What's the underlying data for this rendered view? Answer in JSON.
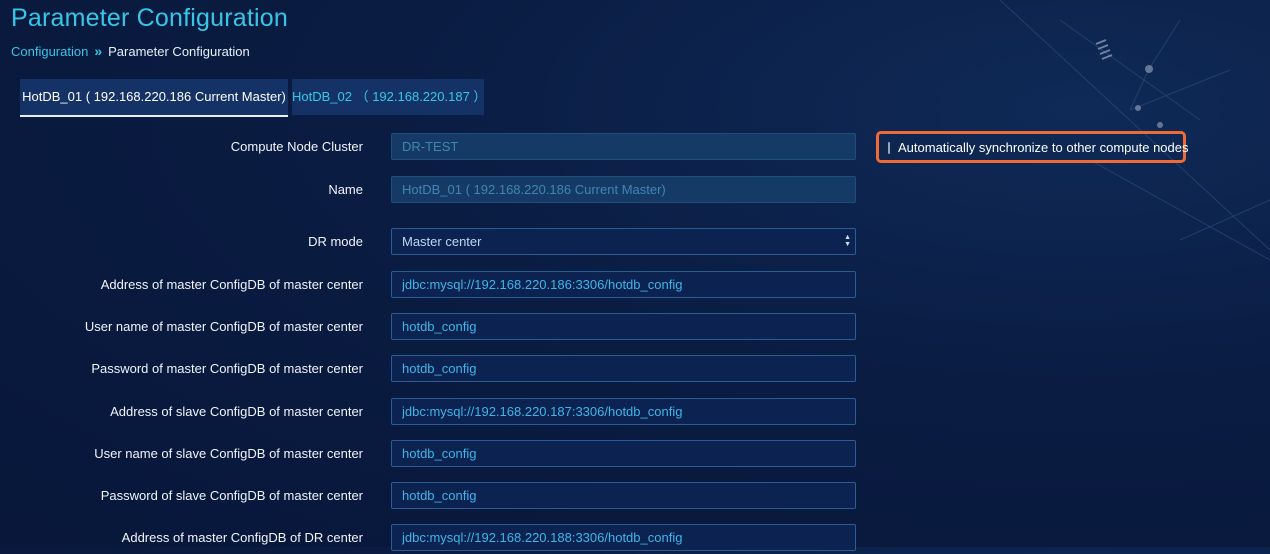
{
  "page": {
    "title": "Parameter Configuration"
  },
  "breadcrumb": {
    "parent": "Configuration",
    "separator": "»",
    "current": "Parameter Configuration"
  },
  "tabs": [
    {
      "label": "HotDB_01 ( 192.168.220.186 Current Master)",
      "active": true
    },
    {
      "label": "HotDB_02 （ 192.168.220.187 ）",
      "active": false
    }
  ],
  "sync": {
    "label": "Automatically synchronize to other compute nodes",
    "checked": false,
    "highlight_color": "#f06a35"
  },
  "form": {
    "cluster": {
      "label": "Compute Node Cluster",
      "value": "DR-TEST"
    },
    "name": {
      "label": "Name",
      "value": "HotDB_01 ( 192.168.220.186 Current Master)"
    },
    "dr_mode": {
      "label": "DR mode",
      "value": "Master center"
    },
    "master_addr": {
      "label": "Address of master ConfigDB of master center",
      "value": "jdbc:mysql://192.168.220.186:3306/hotdb_config"
    },
    "master_user": {
      "label": "User name of master ConfigDB of master center",
      "value": "hotdb_config"
    },
    "master_pass": {
      "label": "Password of master ConfigDB of master center",
      "value": "hotdb_config"
    },
    "slave_addr": {
      "label": "Address of slave ConfigDB of master center",
      "value": "jdbc:mysql://192.168.220.187:3306/hotdb_config"
    },
    "slave_user": {
      "label": "User name of slave ConfigDB of master center",
      "value": "hotdb_config"
    },
    "slave_pass": {
      "label": "Password of slave ConfigDB of master center",
      "value": "hotdb_config"
    },
    "dr_master_addr": {
      "label": "Address of master ConfigDB of DR center",
      "value": "jdbc:mysql://192.168.220.188:3306/hotdb_config"
    }
  },
  "colors": {
    "accent": "#36c7e8",
    "background": "#0a1c42",
    "tab_bg": "#143266",
    "input_border": "#2b5c94"
  }
}
